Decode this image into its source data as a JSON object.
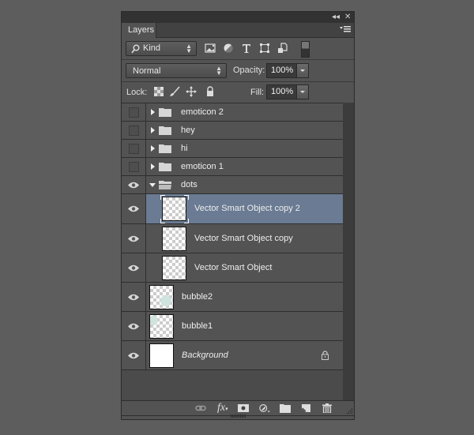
{
  "titlebar": {
    "collapse_icon": "double-chevron-left-icon",
    "close_icon": "close-icon"
  },
  "tabs": [
    {
      "label": "Layers",
      "active": true
    }
  ],
  "panel_menu_icon": "panel-menu-icon",
  "filter": {
    "type_label": "Kind",
    "icons": [
      "pixel-filter-icon",
      "adjustment-filter-icon",
      "type-filter-icon",
      "shape-filter-icon",
      "smart-object-filter-icon",
      "filter-toggle-switch"
    ]
  },
  "blend": {
    "mode": "Normal",
    "opacity_label": "Opacity:",
    "opacity_value": "100%"
  },
  "lock": {
    "label": "Lock:",
    "icons": [
      "lock-transparent-pixels-icon",
      "lock-image-pixels-icon",
      "lock-position-icon",
      "lock-all-icon"
    ],
    "fill_label": "Fill:",
    "fill_value": "100%"
  },
  "layers": [
    {
      "name": "emoticon 2",
      "type": "group",
      "visible": false,
      "expanded": false
    },
    {
      "name": "hey",
      "type": "group",
      "visible": false,
      "expanded": false
    },
    {
      "name": "hi",
      "type": "group",
      "visible": false,
      "expanded": false
    },
    {
      "name": "emoticon 1",
      "type": "group",
      "visible": false,
      "expanded": false
    },
    {
      "name": "dots",
      "type": "group",
      "visible": true,
      "expanded": true
    },
    {
      "name": "Vector Smart Object copy 2",
      "type": "smart-object",
      "visible": true,
      "selected": true,
      "indented": true
    },
    {
      "name": "Vector Smart Object copy",
      "type": "smart-object",
      "visible": true,
      "indented": true
    },
    {
      "name": "Vector Smart Object",
      "type": "smart-object",
      "visible": true,
      "indented": true
    },
    {
      "name": "bubble2",
      "type": "layer",
      "visible": true
    },
    {
      "name": "bubble1",
      "type": "layer",
      "visible": true
    },
    {
      "name": "Background",
      "type": "background",
      "visible": true,
      "locked": true
    }
  ],
  "bottom_toolbar": [
    "link-layers-icon",
    "layer-style-fx-icon",
    "add-mask-icon",
    "new-adjustment-layer-icon",
    "new-group-icon",
    "new-layer-icon",
    "delete-layer-icon"
  ],
  "colors": {
    "selected_row": "#6a7b93",
    "panel_bg": "#535353",
    "bubble_fill": "#cfe3df"
  }
}
